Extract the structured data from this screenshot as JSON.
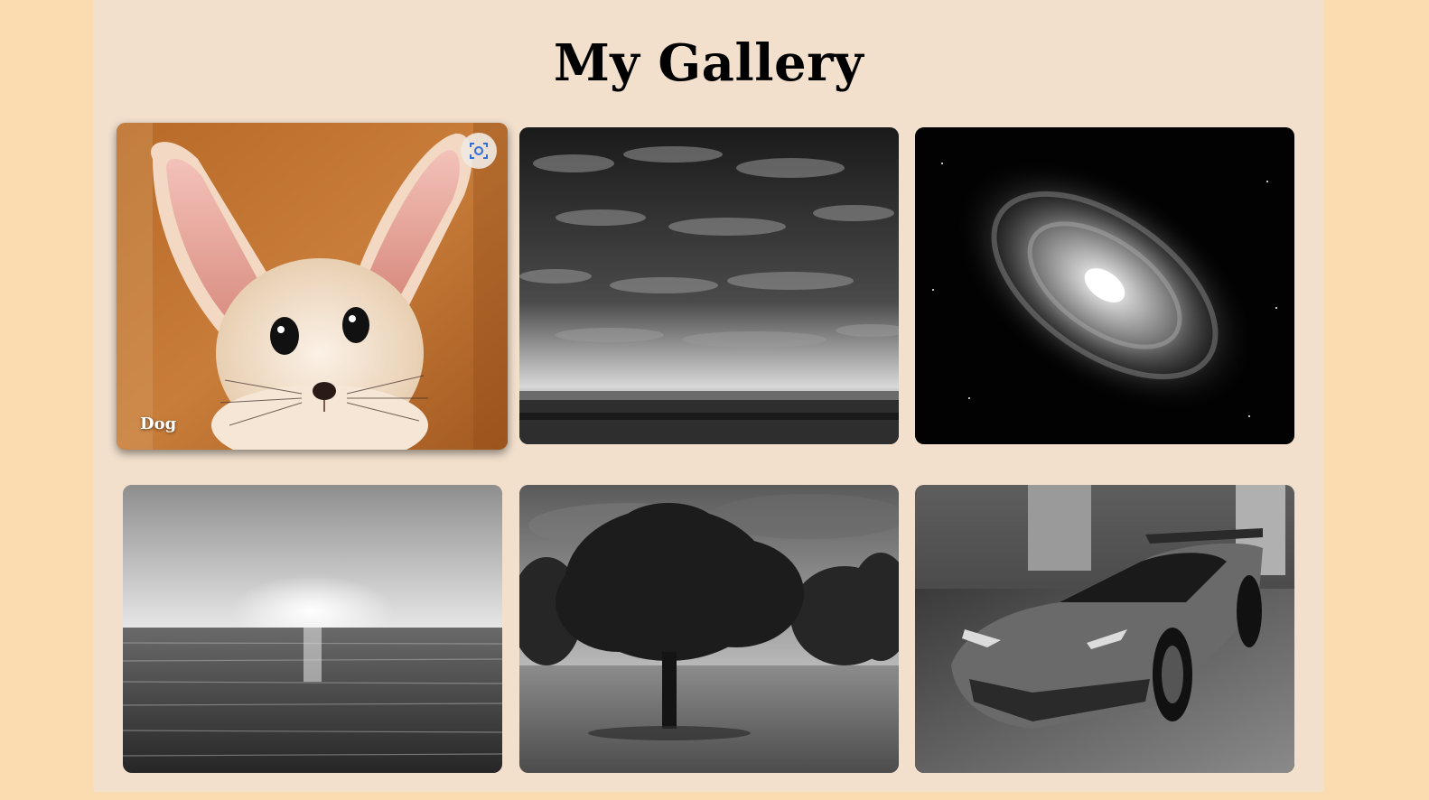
{
  "gallery": {
    "title": "My Gallery",
    "items": [
      {
        "caption": "Dog",
        "image": "fennec-fox-photo",
        "hovered": true
      },
      {
        "caption": "",
        "image": "cloudy-sky-photo",
        "hovered": false
      },
      {
        "caption": "",
        "image": "spiral-galaxy-photo",
        "hovered": false
      },
      {
        "caption": "",
        "image": "sea-sunset-photo",
        "hovered": false
      },
      {
        "caption": "",
        "image": "tree-field-photo",
        "hovered": false
      },
      {
        "caption": "",
        "image": "sports-car-photo",
        "hovered": false
      }
    ]
  },
  "icons": {
    "lens": "visual-search-icon"
  },
  "colors": {
    "outer_background": "#fbdcb1",
    "page_background": "#f2e0cd",
    "title": "#000000",
    "lens_icon": "#2f6fd6"
  }
}
